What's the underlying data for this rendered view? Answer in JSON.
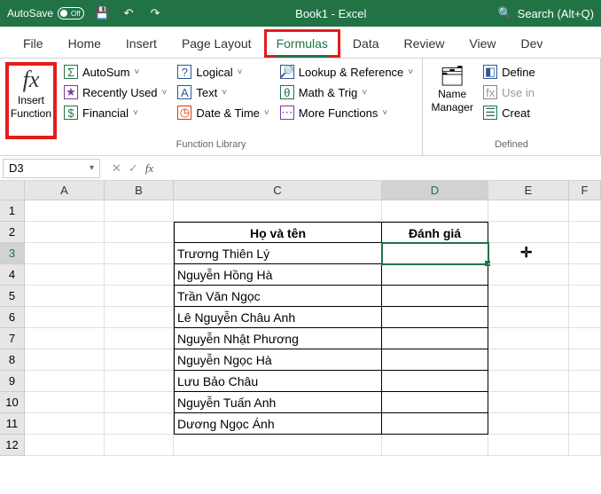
{
  "titlebar": {
    "autosave_label": "AutoSave",
    "autosave_state": "Off",
    "document_title": "Book1 - Excel",
    "search_placeholder": "Search (Alt+Q)"
  },
  "tabs": {
    "file": "File",
    "home": "Home",
    "insert": "Insert",
    "page_layout": "Page Layout",
    "formulas": "Formulas",
    "data": "Data",
    "review": "Review",
    "view": "View",
    "developer": "Dev"
  },
  "ribbon": {
    "insert_function": {
      "line1": "Insert",
      "line2": "Function",
      "icon": "fx"
    },
    "autosum": "AutoSum",
    "recently_used": "Recently Used",
    "financial": "Financial",
    "logical": "Logical",
    "text": "Text",
    "date_time": "Date & Time",
    "lookup_ref": "Lookup & Reference",
    "math_trig": "Math & Trig",
    "more_functions": "More Functions",
    "group_library": "Function Library",
    "name_manager": {
      "line1": "Name",
      "line2": "Manager"
    },
    "define_name": "Define",
    "use_in_formula": "Use in",
    "create_from": "Creat",
    "group_defined": "Defined"
  },
  "formula_bar": {
    "name_box": "D3",
    "formula": ""
  },
  "columns": [
    "A",
    "B",
    "C",
    "D",
    "E",
    "F"
  ],
  "rows": [
    "1",
    "2",
    "3",
    "4",
    "5",
    "6",
    "7",
    "8",
    "9",
    "10",
    "11",
    "12"
  ],
  "table": {
    "header_name": "Họ và tên",
    "header_rating": "Đánh giá",
    "names": [
      "Trương Thiên Lý",
      "Nguyễn Hồng Hà",
      "Trần Văn Ngọc",
      "Lê Nguyễn Châu Anh",
      "Nguyễn Nhật Phương",
      "Nguyễn Ngọc Hà",
      "Lưu Bảo Châu",
      "Nguyễn Tuấn Anh",
      "Dương Ngọc Ánh"
    ]
  },
  "selected_cell": "D3"
}
